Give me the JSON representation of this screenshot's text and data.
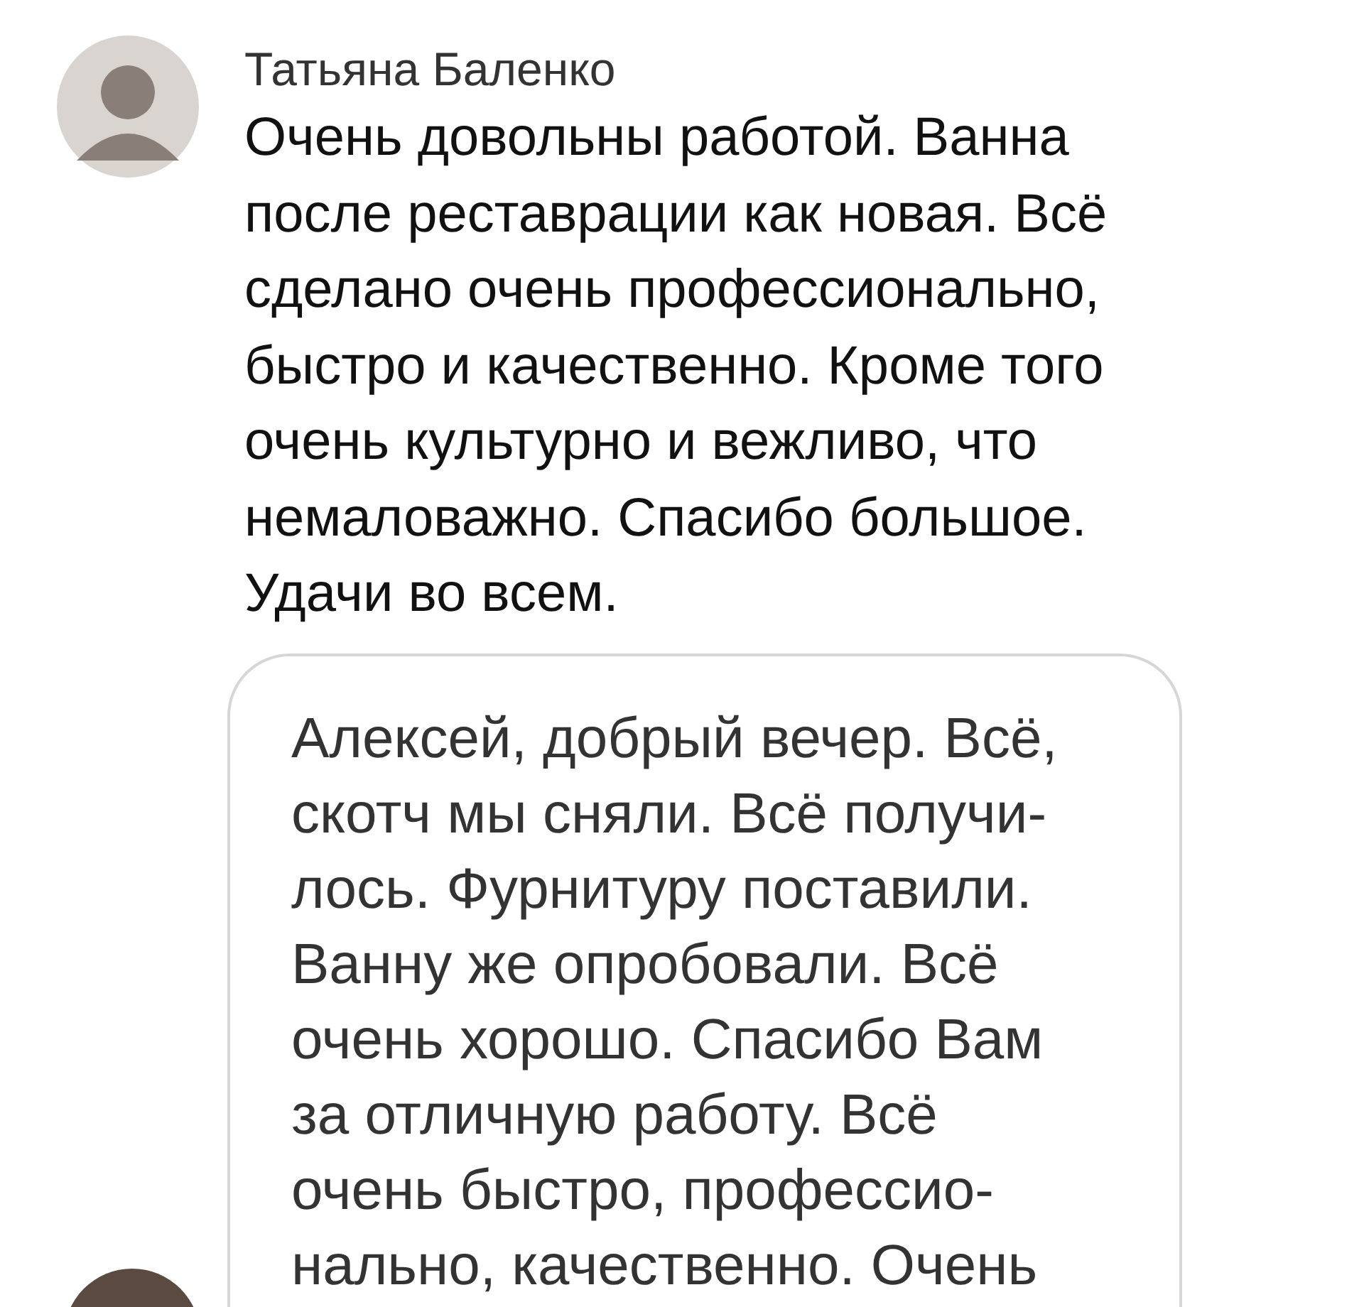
{
  "comment": {
    "author": "Татьяна Баленко",
    "lines": [
      "Очень довольны работой. Ванна",
      "после реставрации как новая. Всё",
      "сделано очень профессионально,",
      "быстро и качественно. Кроме того",
      "очень культурно и вежливо, что",
      "немаловажно. Спасибо большое.",
      "Удачи во всем."
    ]
  },
  "reply_bubble": {
    "lines": [
      "Алексей, добрый вечер. Всё,",
      "скотч мы сняли. Всё получи-",
      "лось. Фурнитуру поставили.",
      "Ванну же опробовали. Всё",
      "очень хорошо. Спасибо Вам",
      "за отличную работу. Всё",
      "очень быстро, профессио-",
      "нально, качественно. Очень"
    ]
  }
}
